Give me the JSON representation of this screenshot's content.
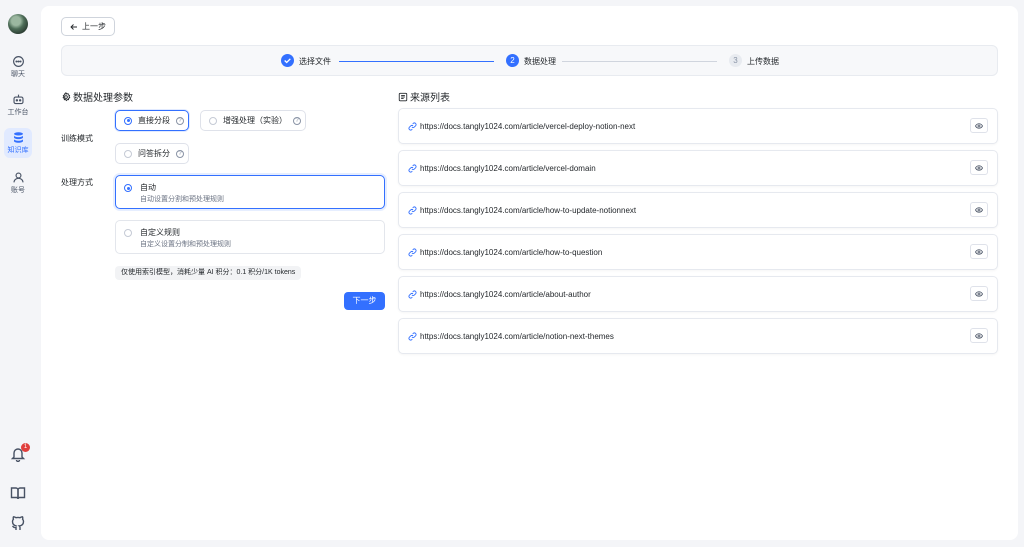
{
  "sidebar": {
    "items": [
      {
        "label": "聊天",
        "icon": "chat-icon"
      },
      {
        "label": "工作台",
        "icon": "robot-icon"
      },
      {
        "label": "知识库",
        "icon": "database-icon",
        "active": true
      },
      {
        "label": "账号",
        "icon": "user-icon"
      }
    ],
    "notification_count": "1"
  },
  "header": {
    "back_label": "上一步"
  },
  "steps": [
    {
      "number": "1",
      "label": "选择文件",
      "status": "done"
    },
    {
      "number": "2",
      "label": "数据处理",
      "status": "active"
    },
    {
      "number": "3",
      "label": "上传数据",
      "status": "pending"
    }
  ],
  "params": {
    "title": "数据处理参数",
    "training_mode_label": "训练模式",
    "training_options": [
      {
        "label": "直接分段",
        "selected": true
      },
      {
        "label": "增强处理（实验）",
        "selected": false
      },
      {
        "label": "问答拆分",
        "selected": false
      }
    ],
    "method_label": "处理方式",
    "methods": [
      {
        "title": "自动",
        "desc": "自动设置分割和预处理规则",
        "selected": true
      },
      {
        "title": "自定义规则",
        "desc": "自定义设置分制和预处理规则",
        "selected": false
      }
    ],
    "hint": "仅使用索引模型，消耗少量 AI 积分：0.1 积分/1K tokens",
    "next_label": "下一步"
  },
  "sources": {
    "title": "来源列表",
    "items": [
      "https://docs.tangly1024.com/article/vercel-deploy-notion-next",
      "https://docs.tangly1024.com/article/vercel-domain",
      "https://docs.tangly1024.com/article/how-to-update-notionnext",
      "https://docs.tangly1024.com/article/how-to-question",
      "https://docs.tangly1024.com/article/about-author",
      "https://docs.tangly1024.com/article/notion-next-themes"
    ]
  },
  "colors": {
    "accent": "#3370ff",
    "badge": "#e0403e"
  }
}
